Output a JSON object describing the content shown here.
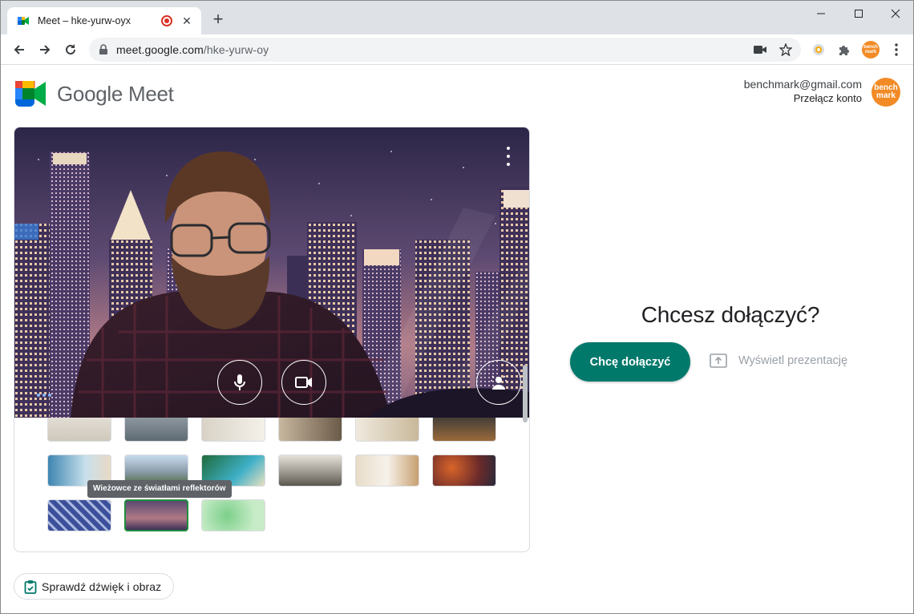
{
  "browser": {
    "tab_title": "Meet – hke-yurw-oyx",
    "tab_close": "✕",
    "new_tab": "+",
    "url_host": "meet.google.com",
    "url_path": "/hke-yurw-oy"
  },
  "header": {
    "product_name": "Google Meet",
    "account_email": "benchmark@gmail.com",
    "switch_account": "Przełącz konto",
    "avatar_text": "bench mark"
  },
  "preview": {
    "tooltip": "Wieżowce ze światłami reflektorów",
    "check_audio_video": "Sprawdź dźwięk i obraz"
  },
  "join": {
    "title": "Chcesz dołączyć?",
    "join_button": "Chcę dołączyć",
    "present_button": "Wyświetl prezentację"
  },
  "colors": {
    "accent_green": "#00796b",
    "selected_border": "#1e8e3e",
    "avatar_orange": "#f28b26"
  },
  "icons": [
    "meet-logo-icon",
    "record-icon",
    "back-icon",
    "forward-icon",
    "reload-icon",
    "lock-icon",
    "camera-icon",
    "star-icon",
    "extensions-icon",
    "microphone-icon",
    "video-camera-icon",
    "background-effects-icon",
    "more-vert-icon",
    "present-icon",
    "clipboard-check-icon"
  ]
}
